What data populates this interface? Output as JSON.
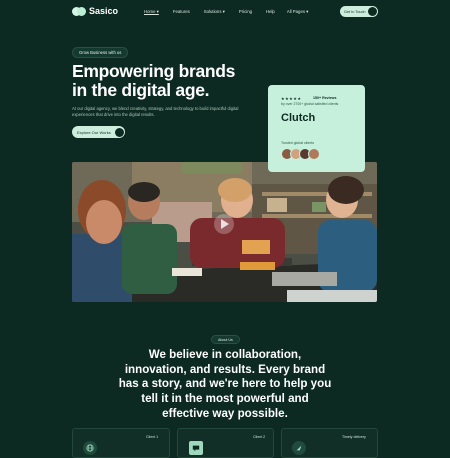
{
  "nav": {
    "brand": "Sasico",
    "items": [
      {
        "label": "Home",
        "active": true
      },
      {
        "label": "Features"
      },
      {
        "label": "Solutions"
      },
      {
        "label": "Pricing"
      },
      {
        "label": "Help"
      },
      {
        "label": "All Pages"
      }
    ],
    "cta": "Get In Touch"
  },
  "hero": {
    "pill": "Grow Business with us",
    "title_line1": "Empowering brands",
    "title_line2": "in the digital age.",
    "desc": "At our digital agency, we blend creativity, strategy, and technology to build impactful digital experiences that drive into the digital results.",
    "button": "Explore Our Works"
  },
  "rating_card": {
    "stars": "★★★★★",
    "reviews": "150+ Reviews",
    "sub": "by over 2700+ global satisfied clients",
    "brand": "Clutch",
    "trusted": "Trusted global clients"
  },
  "about": {
    "pill": "About Us",
    "statement": "We believe in collaboration, innovation, and results. Every brand has a story, and we're here to help you tell it in the most powerful and effective way possible."
  },
  "stats": [
    {
      "label": "Client 1",
      "icon": "globe-icon"
    },
    {
      "label": "Client 2",
      "icon": "chat-icon"
    },
    {
      "label": "Timely delivery",
      "icon": "rocket-icon"
    }
  ],
  "colors": {
    "background": "#0d2a22",
    "accent": "#cdeedd",
    "card": "#c6f0dc"
  }
}
